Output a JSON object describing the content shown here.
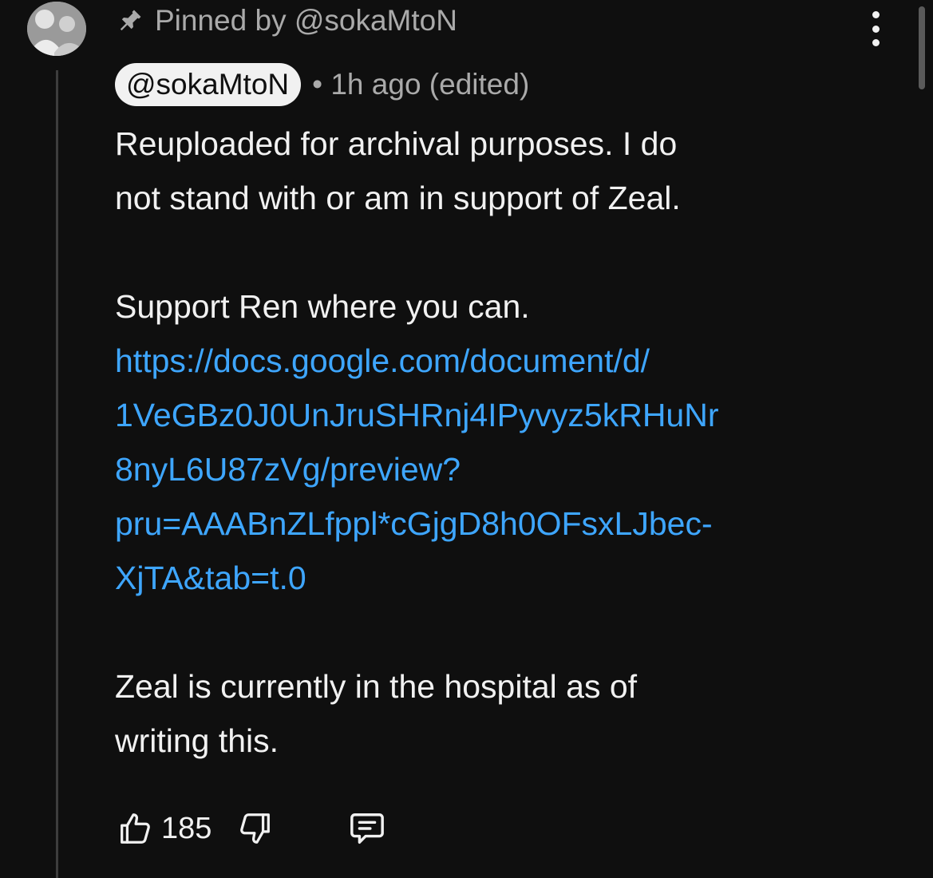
{
  "pinned": {
    "text": "Pinned by @sokaMtoN"
  },
  "comment": {
    "author": "@sokaMtoN",
    "meta": "• 1h ago (edited)",
    "lines": {
      "l1": "Reuploaded for archival purposes. I do",
      "l2": "not stand with or am in support of Zeal.",
      "l3": "Support Ren where you can.",
      "l4": "Zeal is currently in the hospital as of",
      "l5": "writing this."
    },
    "link": {
      "line1": "https://docs.google.com/document/d/",
      "line2": "1VeGBz0J0UnJruSHRnj4IPyvyz5kRHuNr",
      "line3": "8nyL6U87zVg/preview?",
      "line4": "pru=AAABnZLfppl*cGjgD8h0OFsxLJbec-",
      "line5": "XjTA&tab=t.0"
    }
  },
  "actions": {
    "like_count": "185"
  },
  "icons": {
    "pin": "pin-icon",
    "more": "more-vertical-icon",
    "like": "thumbs-up-icon",
    "dislike": "thumbs-down-icon",
    "reply": "reply-comment-icon",
    "avatar": "avatar"
  },
  "colors": {
    "background": "#0f0f0f",
    "text": "#f1f1f1",
    "secondary_text": "#aaaaaa",
    "link": "#3ea6ff",
    "author_chip": "#f1f1f1"
  }
}
